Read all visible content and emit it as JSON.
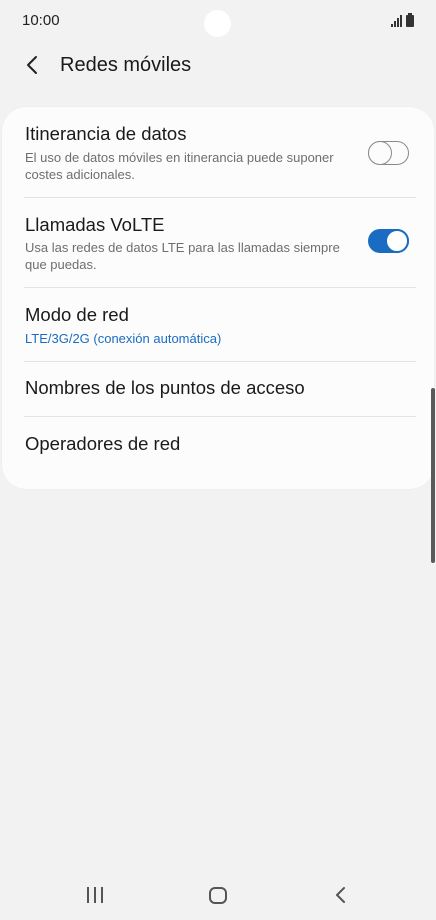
{
  "status_bar": {
    "time": "10:00"
  },
  "header": {
    "title": "Redes móviles",
    "back_icon": "chevron-left-icon"
  },
  "settings": {
    "data_roaming": {
      "title": "Itinerancia de datos",
      "subtitle": "El uso de datos móviles en itinerancia puede suponer costes adicionales.",
      "enabled": false
    },
    "volte_calls": {
      "title": "Llamadas VoLTE",
      "subtitle": "Usa las redes de datos LTE para las llamadas siempre que puedas.",
      "enabled": true
    },
    "network_mode": {
      "title": "Modo de red",
      "value": "LTE/3G/2G (conexión automática)"
    },
    "access_point_names": {
      "title": "Nombres de los puntos de acceso"
    },
    "network_operators": {
      "title": "Operadores de red"
    }
  },
  "colors": {
    "accent": "#1a6cc2",
    "background": "#f2f2f2",
    "card": "#fcfcfc"
  },
  "nav_bar": {
    "icons": [
      "recents-icon",
      "home-icon",
      "back-icon"
    ]
  }
}
